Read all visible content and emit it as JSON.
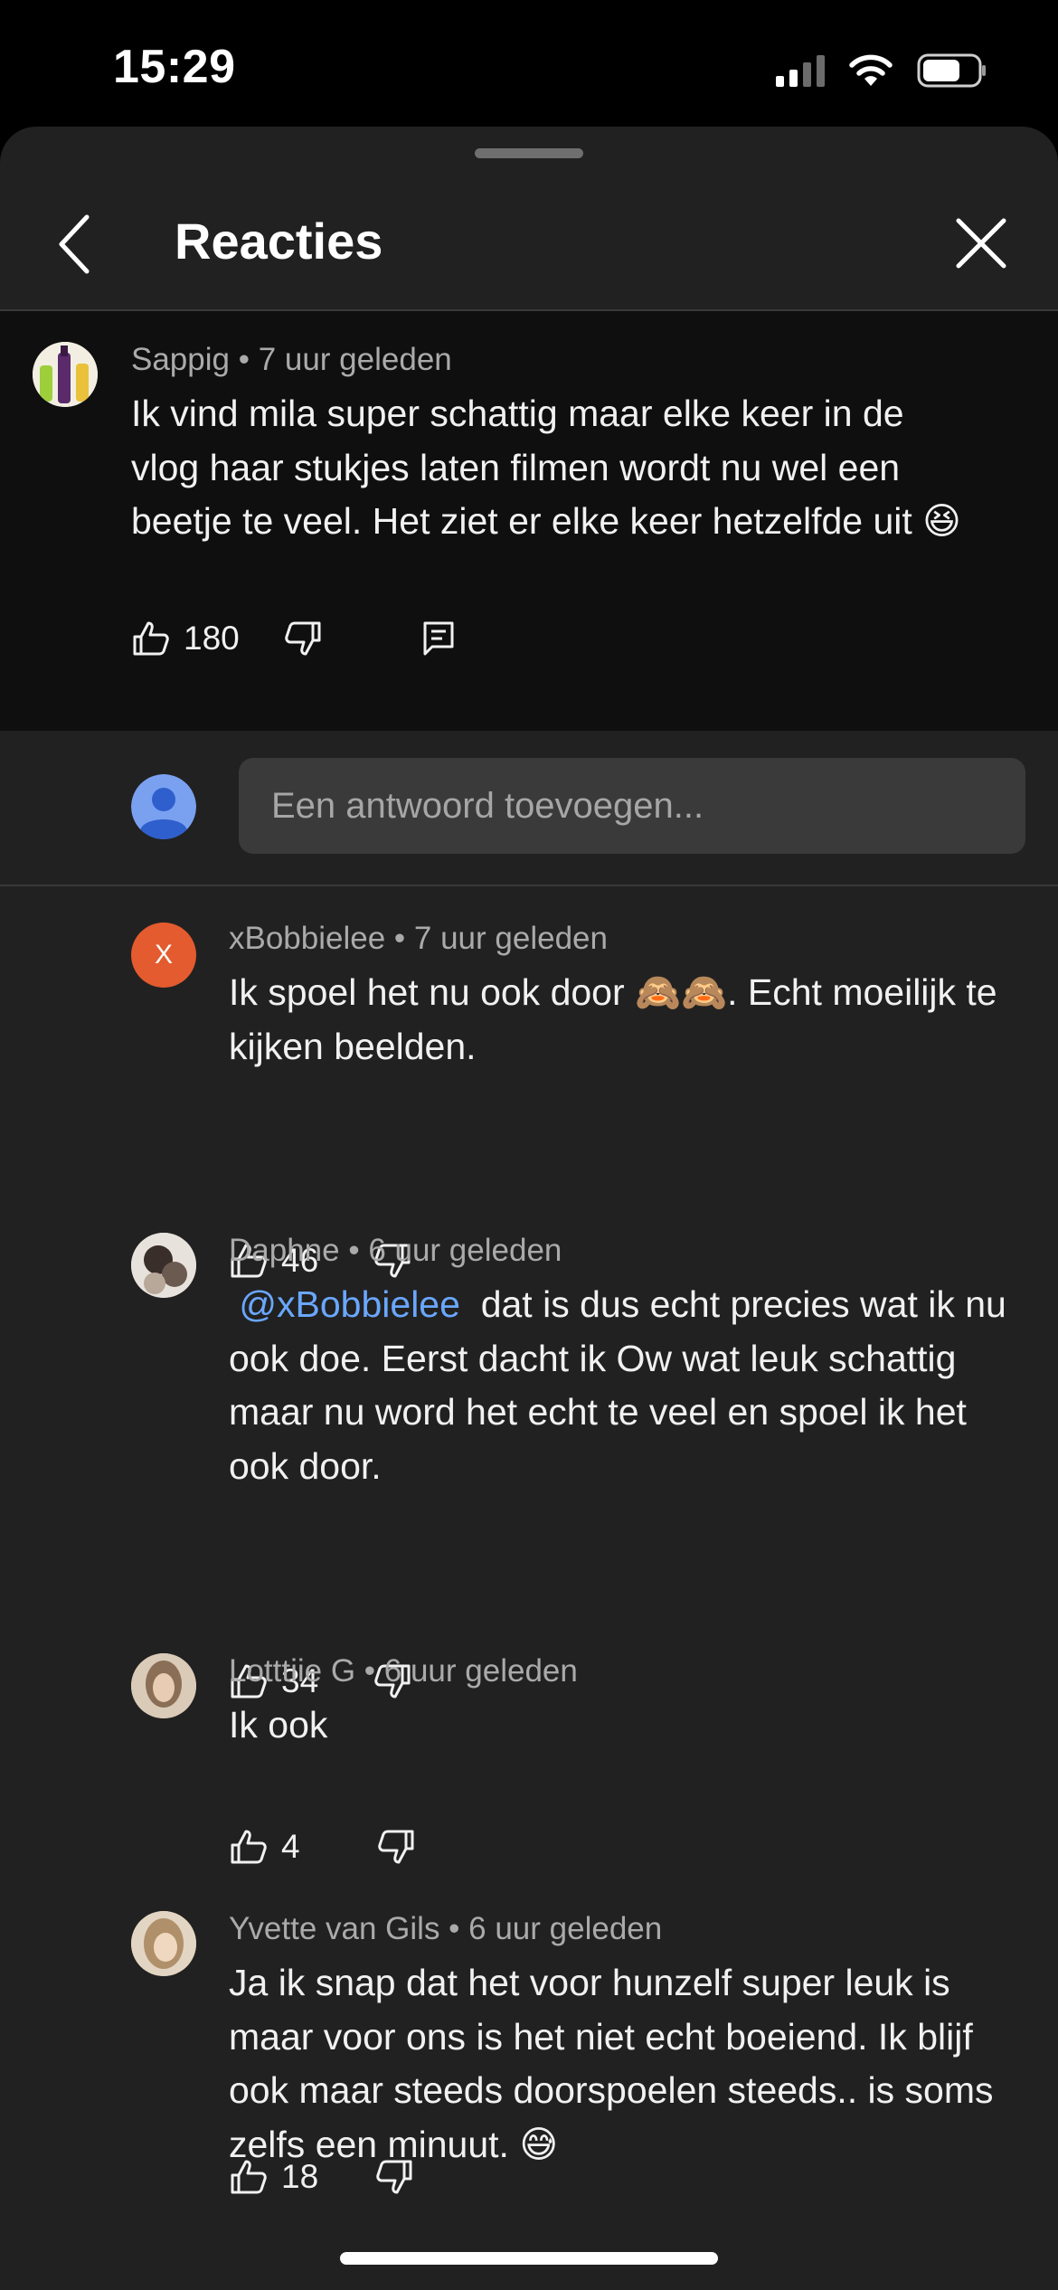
{
  "status_bar": {
    "time": "15:29"
  },
  "header": {
    "title": "Reacties"
  },
  "parent_comment": {
    "author": "Sappig",
    "time": "7 uur geleden",
    "text": "Ik vind mila super schattig maar elke keer in de vlog haar stukjes laten filmen wordt nu wel een beetje te veel. Het ziet er elke keer hetzelfde uit 😆",
    "likes": "180"
  },
  "reply_box": {
    "placeholder": "Een antwoord toevoegen..."
  },
  "replies": [
    {
      "author": "xBobbielee",
      "time": "7 uur geleden",
      "avatar_letter": "X",
      "text": "Ik spoel het nu ook door 🙈🙈. Echt moeilijk te kijken beelden.",
      "likes": "46"
    },
    {
      "author": "Daphne",
      "time": "6 uur geleden",
      "mention": "@xBobbielee",
      "text": "dat is dus echt precies wat ik nu ook doe. Eerst dacht ik Ow wat leuk schattig maar nu word het echt te veel en spoel ik het ook door.",
      "likes": "34"
    },
    {
      "author": "Lotttiie G",
      "time": "6 uur geleden",
      "text": "Ik ook",
      "likes": "4"
    },
    {
      "author": "Yvette van Gils",
      "time": "6 uur geleden",
      "text": "Ja ik snap dat het voor hunzelf super leuk is maar voor ons is het niet echt boeiend. Ik blijf ook maar steeds doorspoelen steeds.. is soms zelfs een minuut. 😅",
      "likes": "18"
    }
  ],
  "colors": {
    "background": "#000000",
    "sheet": "#212121",
    "parent_comment_bg": "#0f0f0f",
    "mention": "#6aa7ff",
    "xbobbielee_avatar": "#e35b2e"
  }
}
